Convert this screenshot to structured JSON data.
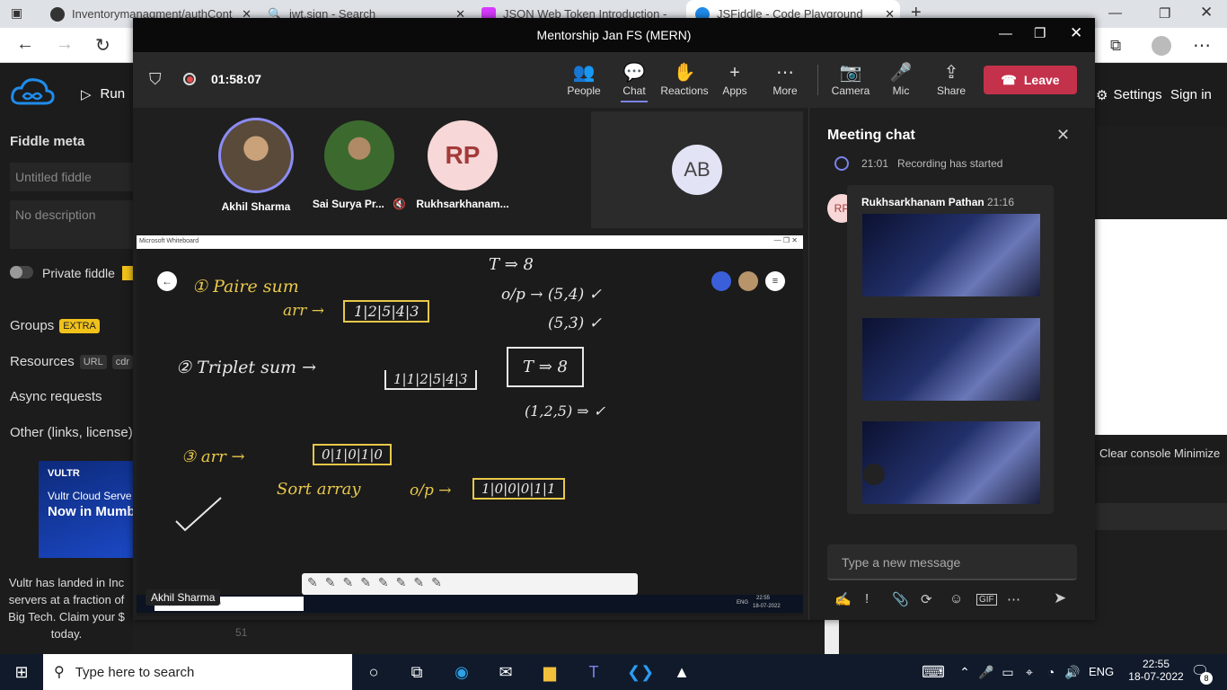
{
  "browser": {
    "tabs": [
      {
        "label": "Inventorymanagment/authCont",
        "color": "#333333"
      },
      {
        "label": "jwt.sign - Search",
        "color": "#2f6fd6"
      },
      {
        "label": "JSON Web Token Introduction -",
        "color": "#d63aff"
      },
      {
        "label": "JSFiddle - Code Playground",
        "color": "#1f8ceb"
      }
    ]
  },
  "fiddle": {
    "run_label": "Run",
    "settings_label": "Settings",
    "signin_label": "Sign in",
    "meta_title": "Fiddle meta",
    "title_placeholder": "Untitled fiddle",
    "desc_placeholder": "No description",
    "private_label": "Private fiddle",
    "groups_label": "Groups",
    "groups_badge": "EXTRA",
    "resources_label": "Resources",
    "resources_badge1": "URL",
    "resources_badge2": "cdr",
    "async_label": "Async requests",
    "other_label": "Other (links, license)",
    "ad_brand": "VULTR",
    "ad_line1": "Vultr Cloud Serve",
    "ad_line2": "Now in Mumb",
    "ad_text1": "Vultr has landed in Inc",
    "ad_text2": "servers at a fraction of",
    "ad_text3": "Big Tech. Claim your $",
    "ad_text4": "today.",
    "clear_console": "Clear console",
    "minimize": "Minimize",
    "line_number": "51"
  },
  "teams": {
    "window_title": "Mentorship Jan FS (MERN)",
    "timer": "01:58:07",
    "toolbar": {
      "people": "People",
      "chat": "Chat",
      "reactions": "Reactions",
      "apps": "Apps",
      "more": "More",
      "camera": "Camera",
      "mic": "Mic",
      "share": "Share",
      "leave": "Leave"
    },
    "participants": [
      {
        "name": "Akhil Sharma"
      },
      {
        "name": "Sai Surya Pr..."
      },
      {
        "name": "Rukhsarkhanam...",
        "initials": "RP"
      }
    ],
    "tile_initials": "AB",
    "whiteboard_title": "Microsoft Whiteboard",
    "speaker_label": "Akhil Sharma",
    "inner_search": "Type here to search",
    "inner_time": "22:55",
    "inner_date": "18-07-2022",
    "inner_lang": "ENG",
    "chat": {
      "title": "Meeting chat",
      "system_time": "21:01",
      "system_text": "Recording has started",
      "sender": "Rukhsarkhanam Pathan",
      "sender_initials": "RP",
      "sender_time": "21:16",
      "input_placeholder": "Type a new message"
    },
    "whiteboard_notes": {
      "n1": "① Paire sum",
      "n2": "arr →",
      "n3": "1|2|5|4|3",
      "n4": "T ⇒ 8",
      "n5": "o/p → (5,4) ✓",
      "n6": "(5,3) ✓",
      "n7": "② Triplet sum →",
      "n8": "1|1|2|5|4|3",
      "n9": "T ⇒ 8",
      "n10": "(1,2,5) ⇒ ✓",
      "n11": "③ arr →",
      "n12": "0|1|0|1|0",
      "n13": "Sort array",
      "n14": "o/p →",
      "n15": "1|0|0|0|1|1"
    }
  },
  "taskbar": {
    "search_placeholder": "Type here to search",
    "lang": "ENG",
    "time": "22:55",
    "date": "18-07-2022",
    "notif_count": "8"
  }
}
